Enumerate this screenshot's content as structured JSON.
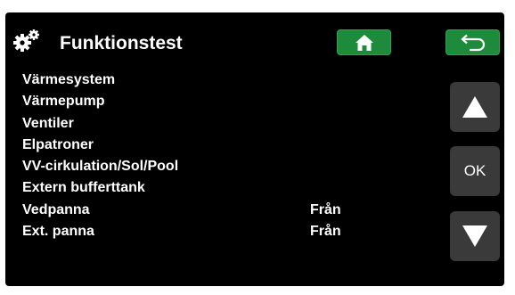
{
  "header": {
    "icon": "gears-icon",
    "title": "Funktionstest",
    "home_icon": "home-icon",
    "back_icon": "return-arrow-icon",
    "button_color": "#1e8a3c"
  },
  "menu": {
    "items": [
      {
        "label": "Värmesystem",
        "value": ""
      },
      {
        "label": "Värmepump",
        "value": ""
      },
      {
        "label": "Ventiler",
        "value": ""
      },
      {
        "label": "Elpatroner",
        "value": ""
      },
      {
        "label": "VV-cirkulation/Sol/Pool",
        "value": ""
      },
      {
        "label": "Extern bufferttank",
        "value": ""
      },
      {
        "label": "Vedpanna",
        "value": "Från"
      },
      {
        "label": "Ext. panna",
        "value": "Från"
      }
    ]
  },
  "navigation": {
    "up_icon": "triangle-up-icon",
    "ok_label": "OK",
    "down_icon": "triangle-down-icon"
  }
}
